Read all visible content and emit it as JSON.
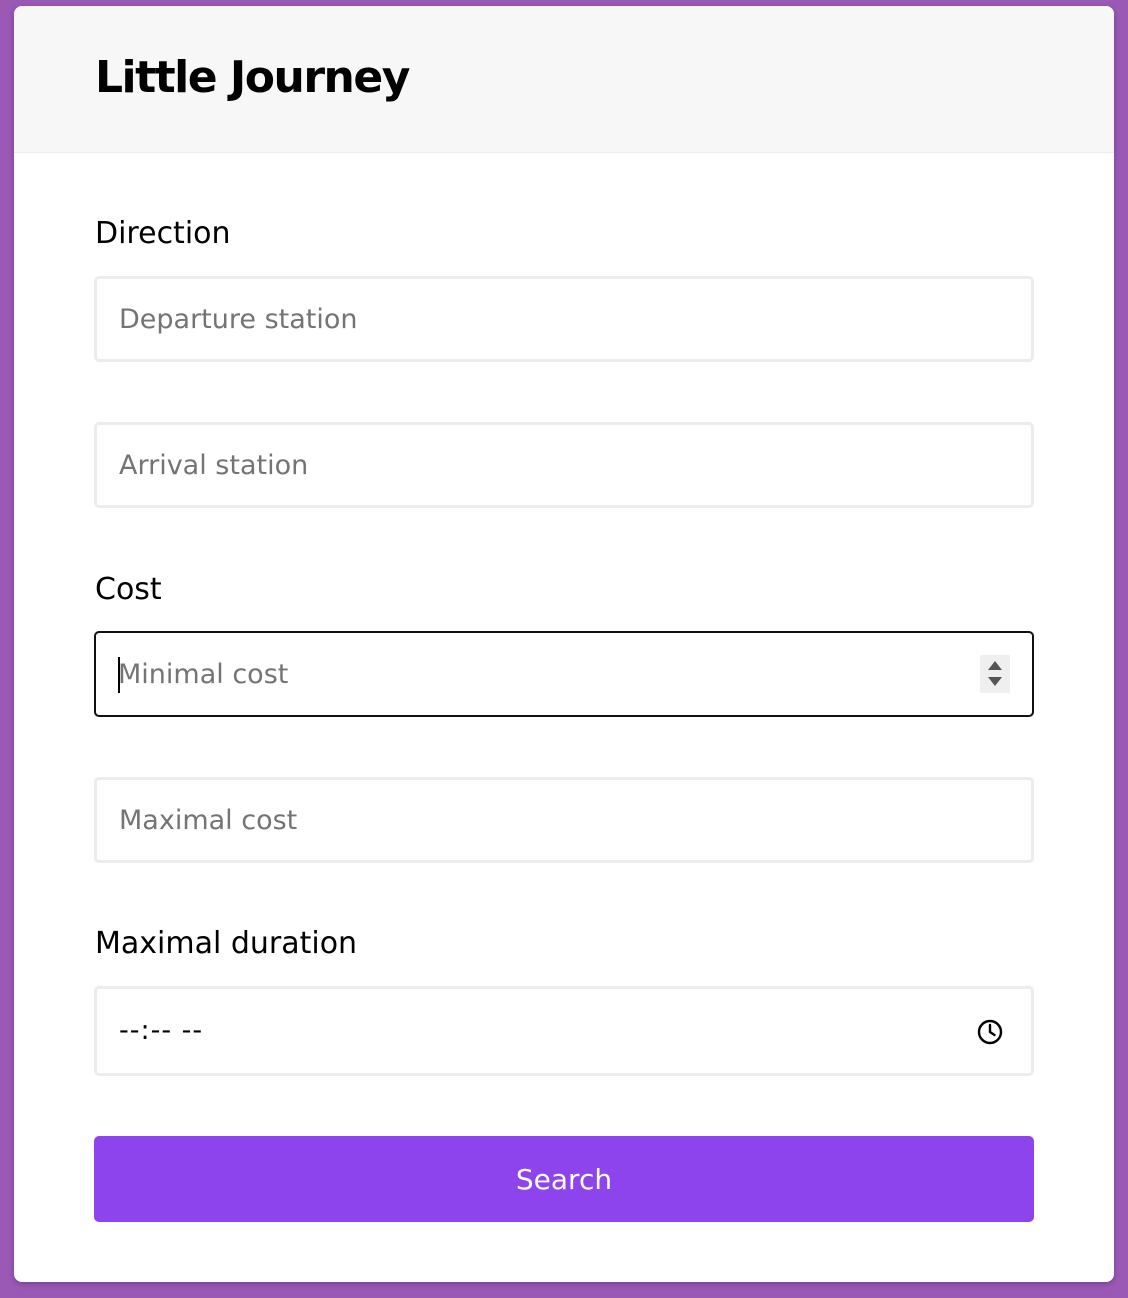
{
  "app": {
    "title": "Little Journey",
    "accent_color": "#8e44ec",
    "background_color": "#9b59b6"
  },
  "direction": {
    "label": "Direction",
    "departure": {
      "value": "",
      "placeholder": "Departure station"
    },
    "arrival": {
      "value": "",
      "placeholder": "Arrival station"
    }
  },
  "cost": {
    "label": "Cost",
    "minimal": {
      "value": "",
      "placeholder": "Minimal cost",
      "focused": true
    },
    "maximal": {
      "value": "",
      "placeholder": "Maximal cost"
    }
  },
  "duration": {
    "label": "Maximal duration",
    "value_display": "--:-- --",
    "icon": "clock-icon"
  },
  "actions": {
    "search_label": "Search"
  }
}
